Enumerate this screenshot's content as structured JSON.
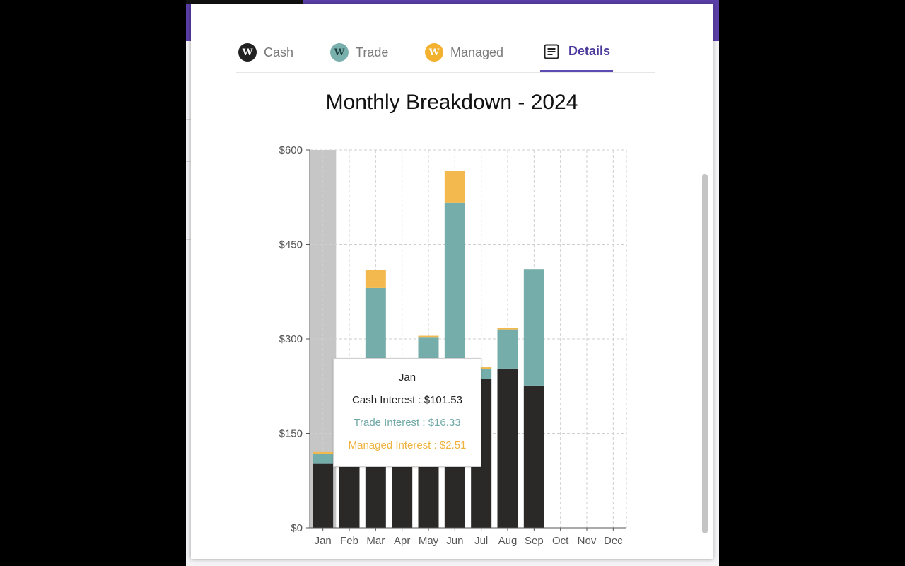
{
  "tabs": [
    {
      "label": "Cash",
      "logo": "W",
      "icon": "wealthsimple-w-icon",
      "color": "#222222",
      "text_color": "#ffffff"
    },
    {
      "label": "Trade",
      "logo": "W",
      "icon": "wealthsimple-w-icon",
      "color": "#79b0ad",
      "text_color": "#1d3f3d"
    },
    {
      "label": "Managed",
      "logo": "W",
      "icon": "wealthsimple-w-icon",
      "color": "#f2b12e",
      "text_color": "#ffffff"
    },
    {
      "label": "Details",
      "icon": "document-icon",
      "active": true
    }
  ],
  "colors": {
    "accent": "#5b4bb2",
    "cash": "#2b2927",
    "trade": "#75adab",
    "managed": "#f3b94f",
    "hover": "#c6c6c6"
  },
  "chart_data": {
    "type": "bar",
    "stacked": true,
    "title": "Monthly Breakdown - 2024",
    "categories": [
      "Jan",
      "Feb",
      "Mar",
      "Apr",
      "May",
      "Jun",
      "Jul",
      "Aug",
      "Sep",
      "Oct",
      "Nov",
      "Dec"
    ],
    "series": [
      {
        "name": "Cash Interest",
        "color": "#2b2927",
        "values": [
          101.53,
          100,
          100,
          100,
          100,
          100,
          237,
          253,
          226,
          0,
          0,
          0
        ]
      },
      {
        "name": "Trade Interest",
        "color": "#75adab",
        "values": [
          16.33,
          0,
          281,
          0,
          202,
          416,
          15,
          62,
          185,
          0,
          0,
          0
        ]
      },
      {
        "name": "Managed Interest",
        "color": "#f3b94f",
        "values": [
          2.51,
          0,
          29,
          0,
          3,
          51,
          3,
          3,
          0,
          0,
          0,
          0
        ]
      }
    ],
    "yticks": [
      "$0",
      "$150",
      "$300",
      "$450",
      "$600"
    ],
    "ylim": [
      0,
      600
    ],
    "grid": true,
    "highlight_index": 0
  },
  "tooltip": {
    "title": "Jan",
    "lines": [
      {
        "text": "Cash Interest : $101.53",
        "color": "#222222"
      },
      {
        "text": "Trade Interest : $16.33",
        "color": "#6fa9a6"
      },
      {
        "text": "Managed Interest : $2.51",
        "color": "#efb23f"
      }
    ]
  }
}
